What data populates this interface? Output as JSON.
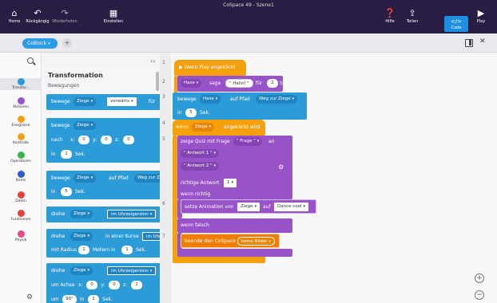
{
  "window": {
    "title": "CoSpace 49 - Szene1"
  },
  "topbar": {
    "home": "Home",
    "undo": "Rückgängig",
    "redo": "Wiederholen",
    "settings": "Einstellen",
    "help": "Hilfe",
    "share": "Teilen",
    "code": "Code",
    "play": "Play"
  },
  "toolbar": {
    "tab": "CoBlock",
    "plus": "+"
  },
  "search": {
    "collapse": "‹‹"
  },
  "categories": [
    {
      "label": "Transfor...",
      "color": "#2c9cd9"
    },
    {
      "label": "Aktionen",
      "color": "#9953c9"
    },
    {
      "label": "Ereignisse",
      "color": "#f5a00c"
    },
    {
      "label": "Kontrolle",
      "color": "#f0a31a"
    },
    {
      "label": "Operatoren",
      "color": "#3ab54a"
    },
    {
      "label": "Items",
      "color": "#2e5dc8"
    },
    {
      "label": "Daten",
      "color": "#e8423c"
    },
    {
      "label": "Funktionen",
      "color": "#e8423c"
    },
    {
      "label": "Physik",
      "color": "#e54a8b"
    }
  ],
  "palette": {
    "heading": "Transformation",
    "subheading": "Bewegungen",
    "b1": {
      "text": "bewege",
      "obj": "Ziege",
      "dir": "vorwärts",
      "for": "für"
    },
    "b2": {
      "text": "bewege",
      "obj": "Ziege",
      "nach": "nach",
      "x": "x:",
      "xv": "0",
      "y": "y:",
      "yv": "0",
      "z": "z:",
      "zv": "0",
      "in": "in",
      "time": "1",
      "sek": "Sek."
    },
    "b3": {
      "text": "bewege",
      "obj": "Ziege",
      "path": "auf Pfad",
      "pathv": "Weg zur Zi",
      "in": "in",
      "time": "5",
      "sek": "Sek."
    },
    "b4": {
      "text": "drehe",
      "obj": "Ziege",
      "dir": "im Uhrzeigersinn"
    },
    "b5": {
      "text": "drehe",
      "obj": "Ziege",
      "curve": "in einer Kurve",
      "dir": "im Uhrz",
      "radius": "mit Radius",
      "rv": "1",
      "m": "Metern in",
      "time": "1",
      "sek": "Sek."
    },
    "b6": {
      "text": "drehe",
      "obj": "Ziege",
      "dir": "im Uhrzeigersinn",
      "axis": "um Achse",
      "x": "x:",
      "xv": "0",
      "y": "y:",
      "yv": "0",
      "z": "z:",
      "zv": "1",
      "um": "um",
      "deg": "90°",
      "in": "in",
      "time": "1",
      "sek": "Sek."
    }
  },
  "lines": [
    "1",
    "2",
    "3",
    "4",
    "5",
    "6",
    "7"
  ],
  "code": {
    "play_event": "Wenn Play angeklickt",
    "say": {
      "obj": "Hase",
      "verb": "sage",
      "msg": "\" Hallo! \"",
      "for": "für",
      "time": "2",
      "sek": "Sek."
    },
    "move": {
      "verb": "bewege",
      "obj": "Hase",
      "path": "auf Pfad",
      "pathv": "Weg zur Ziege",
      "in": "in",
      "time": "5",
      "sek": "Sek."
    },
    "click_event": {
      "when": "wenn",
      "obj": "Ziege",
      "rest": "angeklickt wird"
    },
    "quiz": {
      "label": "zeige Quiz mit Frage",
      "q": "\" Frage \"",
      "an": "an",
      "a1": "\" Antwort 1 \"",
      "a2": "\" Antwort 2 \"",
      "correct": "richtige Antwort",
      "correctv": "1",
      "if_right": "wenn richtig",
      "anim": "setze Animation von",
      "anim_obj": "Ziege",
      "anim_on": "auf",
      "anim_v": "Dance cool",
      "if_wrong": "wenn falsch",
      "end": "beende den CoSpace",
      "endv": "keine Bilder"
    }
  },
  "zoom": {
    "in": "+",
    "out": "−"
  }
}
